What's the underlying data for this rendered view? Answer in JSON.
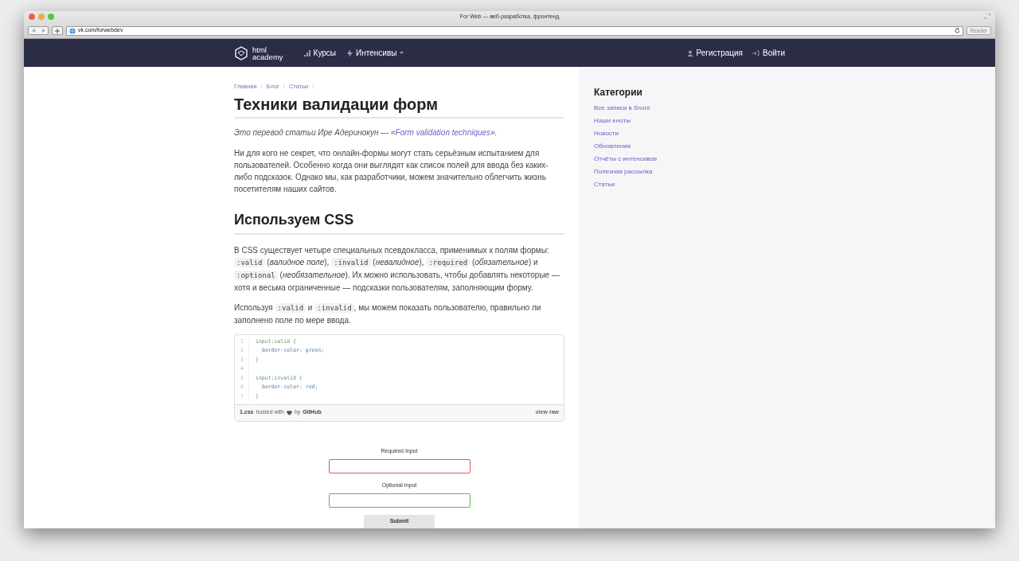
{
  "window": {
    "title": "For Web — веб-разработка, фронтенд"
  },
  "toolbar": {
    "address": "vk.com/forwebdev",
    "reader_button": {
      "label": "Reader",
      "disabled": true
    }
  },
  "site_nav": {
    "logo": [
      "html",
      "academy"
    ],
    "left": [
      {
        "label": "Курсы",
        "kind": "bars",
        "dropdown": false
      },
      {
        "label": "Интенсивы",
        "kind": "bolt",
        "dropdown": true
      }
    ],
    "right": [
      {
        "label": "Регистрация",
        "kind": "person"
      },
      {
        "label": "Войти",
        "kind": "login"
      }
    ]
  },
  "breadcrumbs": {
    "items": [
      "Главная",
      "Блог",
      "Статьи"
    ],
    "separator": "/"
  },
  "article": {
    "title": "Техники валидации форм",
    "intro": [
      {
        "kind": "text",
        "text": "Это перевод статьи Ире Адеринокун — «"
      },
      {
        "kind": "link",
        "text": "Form validation techniques"
      },
      {
        "kind": "text",
        "text": "»."
      }
    ],
    "blocks": [
      {
        "kind": "paragraph",
        "parts": [
          {
            "kind": "text",
            "text": "Ни для кого не секрет, что онлайн-формы могут стать серьёзным испытанием для пользователей. Особенно когда они выглядят как список полей для ввода без каких-либо подсказок. Однако мы, как разработчики, можем значительно облегчить жизнь посетителям наших сайтов."
          }
        ]
      },
      {
        "kind": "heading",
        "text": "Используем CSS"
      },
      {
        "kind": "paragraph",
        "parts": [
          {
            "kind": "text",
            "text": "В CSS существует четыре специальных псевдокласса, применимых к полям формы: "
          },
          {
            "kind": "code",
            "text": ":valid"
          },
          {
            "kind": "text",
            "text": " (*валидное поле*), "
          },
          {
            "kind": "code",
            "text": ":invalid"
          },
          {
            "kind": "text",
            "text": " (*невалидное*), "
          },
          {
            "kind": "code",
            "text": ":required"
          },
          {
            "kind": "text",
            "text": " (*обязательное*) и "
          },
          {
            "kind": "code",
            "text": ":optional"
          },
          {
            "kind": "text",
            "text": " (*необязательное*). Их можно использовать, чтобы добавлять некоторые — хотя и весьма ограниченные — подсказки пользователям, заполняющим форму."
          }
        ]
      },
      {
        "kind": "paragraph",
        "parts": [
          {
            "kind": "text",
            "text": "Используя "
          },
          {
            "kind": "code",
            "text": ":valid"
          },
          {
            "kind": "text",
            "text": " и "
          },
          {
            "kind": "code",
            "text": ":invalid"
          },
          {
            "kind": "text",
            "text": ", мы можем показать пользователю, правильно ли заполнено поле по мере ввода."
          }
        ]
      },
      {
        "kind": "gist",
        "lines": [
          {
            "number": "1",
            "kind": "selector",
            "code": "input:valid {"
          },
          {
            "number": "2",
            "kind": "property",
            "code": "border-color: green;"
          },
          {
            "number": "3",
            "kind": "brace",
            "code": "}"
          },
          {
            "number": "4"
          },
          {
            "number": "5",
            "kind": "selector",
            "code": "input:invalid {"
          },
          {
            "number": "6",
            "kind": "property",
            "code": "border-color: red;"
          },
          {
            "number": "7",
            "kind": "brace",
            "code": "}"
          }
        ],
        "footer": {
          "file": "1.css",
          "hosted": "hosted with",
          "by": "by",
          "host": "GitHub",
          "view_raw": "view raw"
        }
      },
      {
        "kind": "form_demo",
        "fields": [
          {
            "label": "Required Input",
            "valid": false
          },
          {
            "label": "Optional Input",
            "valid": true
          }
        ],
        "submit": "Submit"
      }
    ]
  },
  "sidebar": {
    "heading": "Категории",
    "links": [
      "Все записи в блоге",
      "Наши еноты",
      "Новости",
      "Обновления",
      "Отчёты с интенсивов",
      "Полезная рассылка",
      "Статьи"
    ]
  }
}
